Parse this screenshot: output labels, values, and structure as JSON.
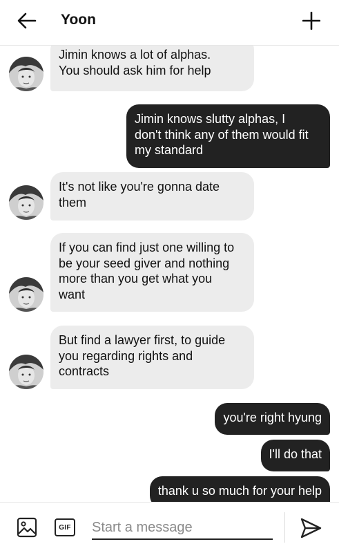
{
  "header": {
    "title": "Yoon"
  },
  "messages": [
    {
      "direction": "in",
      "text": "Jimin knows a lot of alphas.\nYou should ask him for help"
    },
    {
      "direction": "out",
      "text": "Jimin knows slutty alphas, I\ndon't think any of them would fit\nmy standard"
    },
    {
      "direction": "in",
      "text": "It's not like you're gonna date\nthem"
    },
    {
      "direction": "in",
      "text": "If you can find just one willing to\nbe your seed giver and nothing\nmore than you get what you\nwant"
    },
    {
      "direction": "in",
      "text": "But find a lawyer first, to guide\nyou regarding rights and\ncontracts"
    },
    {
      "direction": "out",
      "text": "you're right hyung"
    },
    {
      "direction": "out",
      "text": "I'll do that"
    },
    {
      "direction": "out",
      "text": "thank u so much for your help"
    }
  ],
  "composer": {
    "placeholder": "Start a message",
    "gif_label": "GIF"
  },
  "icons": {
    "back": "arrow-left-icon",
    "new": "plus-icon",
    "image": "image-icon",
    "gif": "gif-icon",
    "send": "send-icon",
    "avatar": "avatar-photo"
  },
  "colors": {
    "incoming_bubble": "#ececec",
    "outgoing_bubble": "#222222",
    "outgoing_text": "#ffffff"
  }
}
